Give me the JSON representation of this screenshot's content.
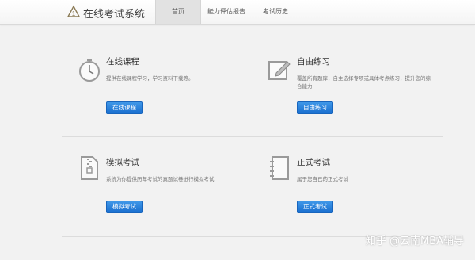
{
  "header": {
    "app_title": "在线考试系统",
    "tabs": [
      {
        "label": "首页",
        "active": true
      },
      {
        "label": "能力评估报告",
        "active": false
      },
      {
        "label": "考试历史",
        "active": false
      }
    ]
  },
  "cards": [
    {
      "title": "在线课程",
      "desc": "提供在线课程学习，学习资料下载等。",
      "button": "在线课程",
      "icon": "stopwatch-icon"
    },
    {
      "title": "自由练习",
      "desc": "覆盖所有题库，自主选择专项或具体考点练习，提升您的综合能力",
      "button": "自由练习",
      "icon": "pencil-edit-icon"
    },
    {
      "title": "模拟考试",
      "desc": "系统为你提供历年考试的真题试卷进行模拟考试",
      "button": "模拟考试",
      "icon": "zip-document-icon"
    },
    {
      "title": "正式考试",
      "desc": "属于您自己的正式考试",
      "button": "正式考试",
      "icon": "notebook-icon"
    }
  ],
  "watermark": "知乎 @云南MBA辅导",
  "accent_color": "#1a6fcf"
}
